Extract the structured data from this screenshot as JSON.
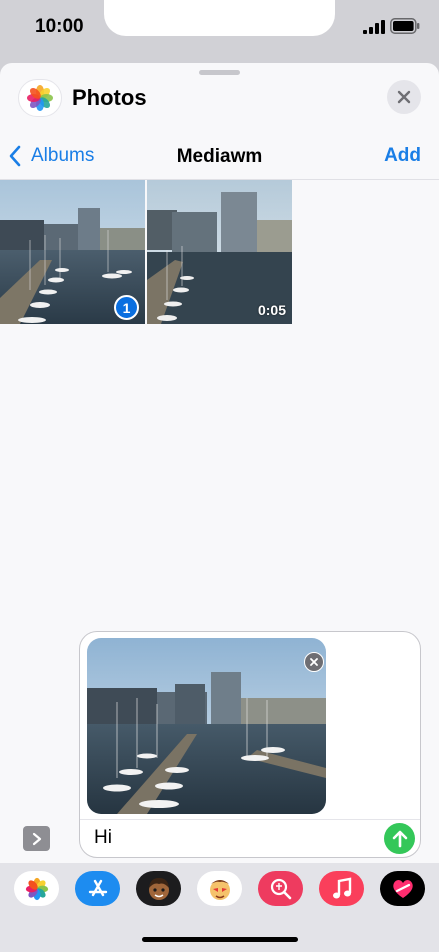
{
  "status_bar": {
    "time": "10:00"
  },
  "sheet": {
    "title": "Photos",
    "nav": {
      "back_label": "Albums",
      "title": "Mediawm",
      "add_label": "Add"
    }
  },
  "grid": {
    "items": [
      {
        "type": "photo",
        "selected": true,
        "selection_number": "1"
      },
      {
        "type": "video",
        "selected": false,
        "duration": "0:05"
      }
    ]
  },
  "composer": {
    "message": "Hi",
    "attachment": "photo"
  },
  "app_drawer": {
    "apps": [
      "photos-app-icon",
      "app-store-icon",
      "memoji-icon",
      "animoji-icon",
      "image-search-icon",
      "music-icon",
      "digital-touch-icon"
    ]
  },
  "colors": {
    "accent": "#1a7ee6",
    "send": "#34c759",
    "selection": "#0a6fe0"
  }
}
